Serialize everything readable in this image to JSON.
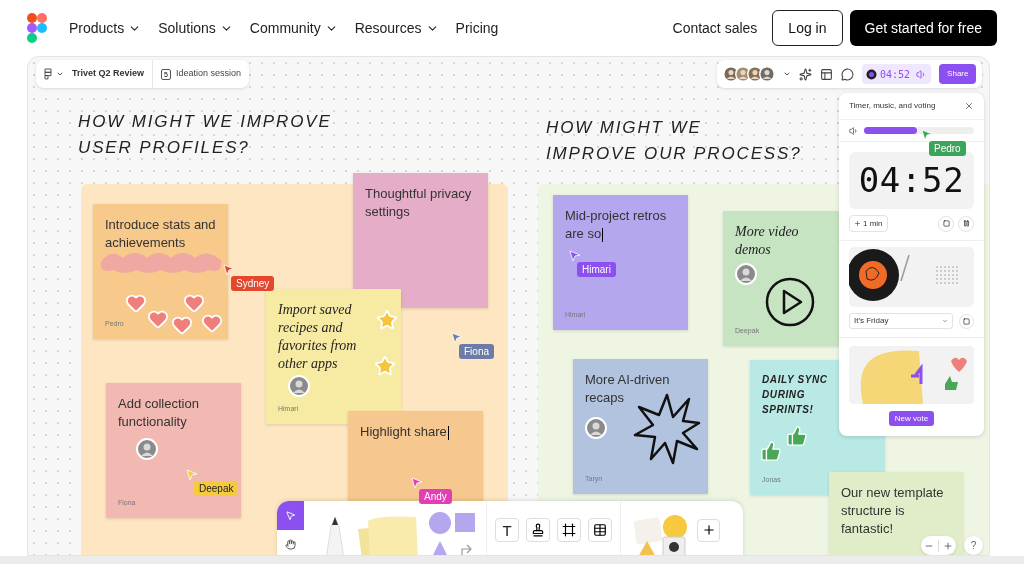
{
  "nav": {
    "links": [
      {
        "label": "Products",
        "dropdown": true
      },
      {
        "label": "Solutions",
        "dropdown": true
      },
      {
        "label": "Community",
        "dropdown": true
      },
      {
        "label": "Resources",
        "dropdown": true
      },
      {
        "label": "Pricing",
        "dropdown": false
      }
    ],
    "contact": "Contact sales",
    "login": "Log in",
    "cta": "Get started for free"
  },
  "board": {
    "file": "Trivet Q2 Review",
    "page_number": "5",
    "page": "Ideation session",
    "timer": "04:52",
    "share": "Share"
  },
  "sections": [
    {
      "title_lines": [
        "HOW MIGHT WE IMPROVE",
        "USER PROFILES?"
      ],
      "color": "#fde6c1"
    },
    {
      "title_lines": [
        "HOW MIGHT WE",
        "IMPROVE OUR PROCESS?"
      ],
      "color": "#eef5e3"
    }
  ],
  "stickies": [
    {
      "text": "Introduce stats and achievements",
      "kind": "typed",
      "color": "#f7c98b",
      "author": "Pedro",
      "editing": false
    },
    {
      "text": "Thoughtful privacy settings",
      "kind": "typed",
      "color": "#e6adc8",
      "editing": false
    },
    {
      "text": "Import saved recipes and favorites from other apps",
      "kind": "handwritten",
      "color": "#f7eba3",
      "author": "Himari",
      "editing": false
    },
    {
      "text": "Add collection functionality",
      "kind": "typed",
      "color": "#f1b9b1",
      "author": "Fiona",
      "editing": false
    },
    {
      "text": "Highlight share",
      "kind": "typed",
      "color": "#f6c78f",
      "editing": true
    },
    {
      "text": "Mid-project retros are so",
      "kind": "typed",
      "color": "#b4a7ed",
      "author": "Himari",
      "editing": true
    },
    {
      "text": "More video demos",
      "kind": "handwritten",
      "color": "#c6e4c1",
      "author": "Deepak",
      "editing": false
    },
    {
      "text": "More AI-driven recaps",
      "kind": "typed",
      "color": "#b1c3df",
      "author": "Taryn",
      "editing": false
    },
    {
      "text": "DAILY SYNC DURING SPRINTS!",
      "kind": "caps",
      "color": "#b9e9e4",
      "author": "Jonas",
      "editing": false
    },
    {
      "text": "Our new template structure is fantastic!",
      "kind": "typed",
      "color": "#e1edc8",
      "editing": false
    }
  ],
  "cursors": [
    {
      "name": "Sydney",
      "color": "#e3472e"
    },
    {
      "name": "Fiona",
      "color": "#6b7ca8"
    },
    {
      "name": "Deepak",
      "color": "#f5cb3c"
    },
    {
      "name": "Andy",
      "color": "#e23fb4"
    },
    {
      "name": "Himari",
      "color": "#8c4ff0"
    },
    {
      "name": "Pedro",
      "color": "#3ba55b"
    }
  ],
  "panel": {
    "title": "Timer, music, and voting",
    "volume": {
      "level": 0.48
    },
    "time": "04:52",
    "add_time": "1 min",
    "track": "It's Friday",
    "vote_button": "New vote"
  },
  "toolbar": {
    "tools": [
      {
        "kind": "select",
        "selected": true
      },
      {
        "kind": "hand",
        "selected": false
      }
    ],
    "text_tool": "T"
  },
  "help": "?"
}
